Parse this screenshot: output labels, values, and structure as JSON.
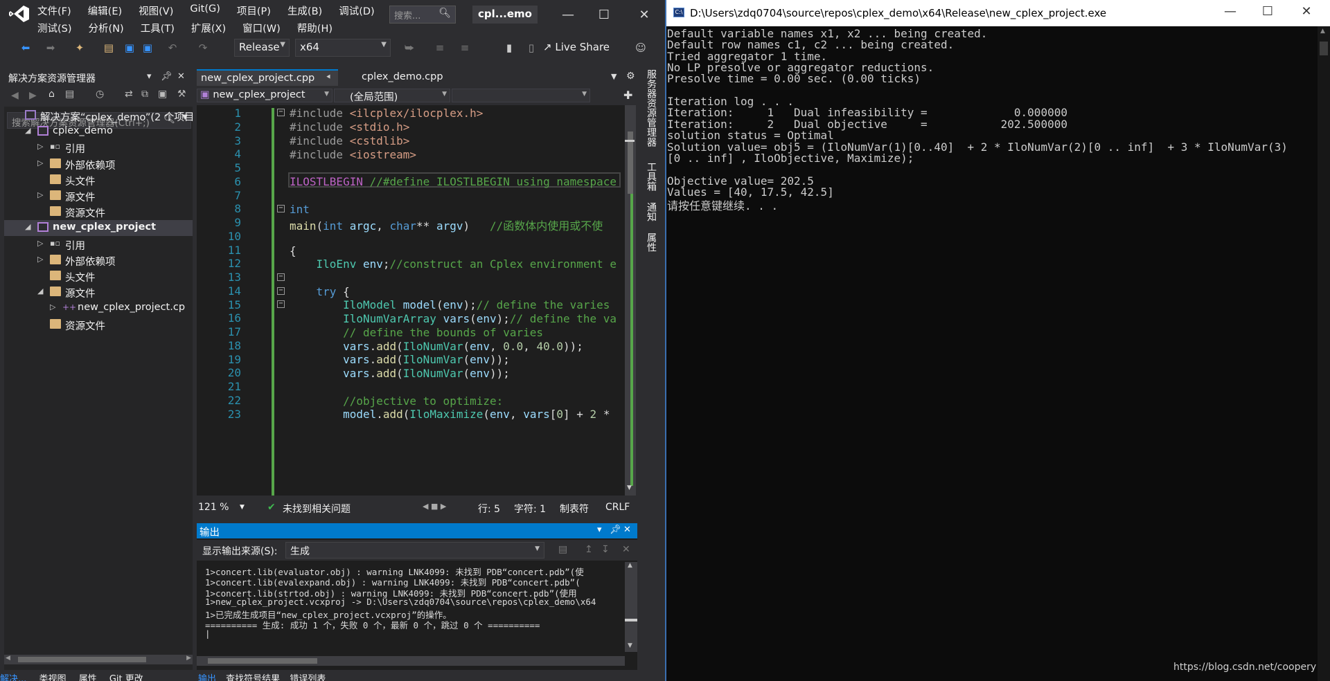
{
  "vs": {
    "menu_row1": [
      "文件(F)",
      "编辑(E)",
      "视图(V)",
      "Git(G)",
      "项目(P)",
      "生成(B)",
      "调试(D)"
    ],
    "menu_row2": [
      "测试(S)",
      "分析(N)",
      "工具(T)",
      "扩展(X)",
      "窗口(W)",
      "帮助(H)"
    ],
    "search_placeholder": "搜索...",
    "solution_short": "cpl...emo",
    "toolbar": {
      "config": "Release",
      "platform": "x64",
      "live_share": "Live Share"
    }
  },
  "solution_explorer": {
    "title": "解决方案资源管理器",
    "search_placeholder": "搜索解决方案资源管理器(Ctrl+;)",
    "tree": [
      {
        "label": "解决方案“cplex_demo”(2 个项目",
        "indent": 0,
        "icon": "solution-icon",
        "tri": ""
      },
      {
        "label": "cplex_demo",
        "indent": 1,
        "icon": "project-icon",
        "tri": "◢"
      },
      {
        "label": "引用",
        "indent": 2,
        "icon": "reference-icon",
        "tri": "▷"
      },
      {
        "label": "外部依赖项",
        "indent": 2,
        "icon": "folder-icon",
        "tri": "▷"
      },
      {
        "label": "头文件",
        "indent": 2,
        "icon": "folder-icon",
        "tri": ""
      },
      {
        "label": "源文件",
        "indent": 2,
        "icon": "folder-icon",
        "tri": "▷"
      },
      {
        "label": "资源文件",
        "indent": 2,
        "icon": "folder-icon",
        "tri": ""
      },
      {
        "label": "new_cplex_project",
        "indent": 1,
        "icon": "project-icon",
        "tri": "◢",
        "bold": true
      },
      {
        "label": "引用",
        "indent": 2,
        "icon": "reference-icon",
        "tri": "▷"
      },
      {
        "label": "外部依赖项",
        "indent": 2,
        "icon": "folder-icon",
        "tri": "▷"
      },
      {
        "label": "头文件",
        "indent": 2,
        "icon": "folder-icon",
        "tri": ""
      },
      {
        "label": "源文件",
        "indent": 2,
        "icon": "folder-open-icon",
        "tri": "◢"
      },
      {
        "label": "new_cplex_project.cp",
        "indent": 3,
        "icon": "cpp-file-icon",
        "tri": "▷"
      },
      {
        "label": "资源文件",
        "indent": 2,
        "icon": "folder-icon",
        "tri": ""
      }
    ],
    "bottom_tabs": [
      "解决...",
      "类视图",
      "属性",
      "Git 更改"
    ]
  },
  "editor": {
    "tabs": [
      "new_cplex_project.cpp",
      "cplex_demo.cpp"
    ],
    "nav_project": "new_cplex_project",
    "nav_scope": "(全局范围)",
    "line_numbers": [
      "1",
      "2",
      "3",
      "4",
      "5",
      "6",
      "7",
      "8",
      "9",
      "10",
      "11",
      "12",
      "13",
      "14",
      "15",
      "16",
      "17",
      "18",
      "19",
      "20",
      "21",
      "22",
      "23"
    ],
    "zoom": "121 %",
    "issues": "未找到相关问题",
    "line": "行: 5",
    "char": "字符: 1",
    "tabs_mode": "制表符",
    "eol": "CRLF",
    "side_labels": [
      "服务器资源管理器",
      "工具箱",
      "通知",
      "属性"
    ]
  },
  "output": {
    "title": "输出",
    "source_label": "显示输出来源(S):",
    "source_value": "生成",
    "lines": [
      "1>concert.lib(evaluator.obj) : warning LNK4099: 未找到 PDB“concert.pdb”(使",
      "1>concert.lib(evalexpand.obj) : warning LNK4099: 未找到 PDB“concert.pdb”(",
      "1>concert.lib(strtod.obj) : warning LNK4099: 未找到 PDB“concert.pdb”(使用",
      "1>new_cplex_project.vcxproj -> D:\\Users\\zdq0704\\source\\repos\\cplex_demo\\x64",
      "1>已完成生成项目“new_cplex_project.vcxproj”的操作。",
      "========== 生成: 成功 1 个，失败 0 个，最新 0 个，跳过 0 个 =========="
    ],
    "bottom_tabs": [
      "输出",
      "查找符号结果",
      "错误列表"
    ]
  },
  "console": {
    "title": "D:\\Users\\zdq0704\\source\\repos\\cplex_demo\\x64\\Release\\new_cplex_project.exe",
    "lines": [
      "Default variable names x1, x2 ... being created.",
      "Default row names c1, c2 ... being created.",
      "Tried aggregator 1 time.",
      "No LP presolve or aggregator reductions.",
      "Presolve time = 0.00 sec. (0.00 ticks)",
      "",
      "Iteration log . . .",
      "Iteration:     1   Dual infeasibility =             0.000000",
      "Iteration:     2   Dual objective     =           202.500000",
      "solution status = Optimal",
      "Solution value= obj5 = (IloNumVar(1)[0..40]  + 2 * IloNumVar(2)[0 .. inf]  + 3 * IloNumVar(3)",
      "[0 .. inf] , IloObjective, Maximize);",
      "",
      "Objective value= 202.5",
      "Values = [40, 17.5, 42.5]",
      "请按任意键继续. . ."
    ]
  },
  "watermark": "https://blog.csdn.net/coopery"
}
